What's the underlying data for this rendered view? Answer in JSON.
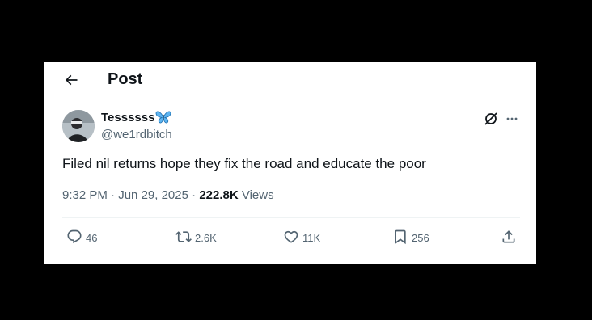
{
  "header": {
    "title": "Post"
  },
  "author": {
    "display_name": "Tessssss",
    "handle": "@we1rdbitch"
  },
  "tweet": {
    "text": "Filed nil returns hope they fix the road and educate the poor"
  },
  "meta": {
    "time": "9:32 PM",
    "separator": " · ",
    "date": "Jun 29, 2025",
    "separator2": " · ",
    "views_count": "222.8K",
    "views_label": " Views"
  },
  "actions": {
    "replies": "46",
    "reposts": "2.6K",
    "likes": "11K",
    "bookmarks": "256"
  },
  "colors": {
    "text_primary": "#0f1419",
    "text_secondary": "#536471",
    "butterfly": "#1d9bf0"
  },
  "icons": [
    "back-arrow-icon",
    "butterfly-emoji-icon",
    "grok-icon",
    "more-icon",
    "reply-icon",
    "repost-icon",
    "like-icon",
    "bookmark-icon",
    "share-icon"
  ]
}
